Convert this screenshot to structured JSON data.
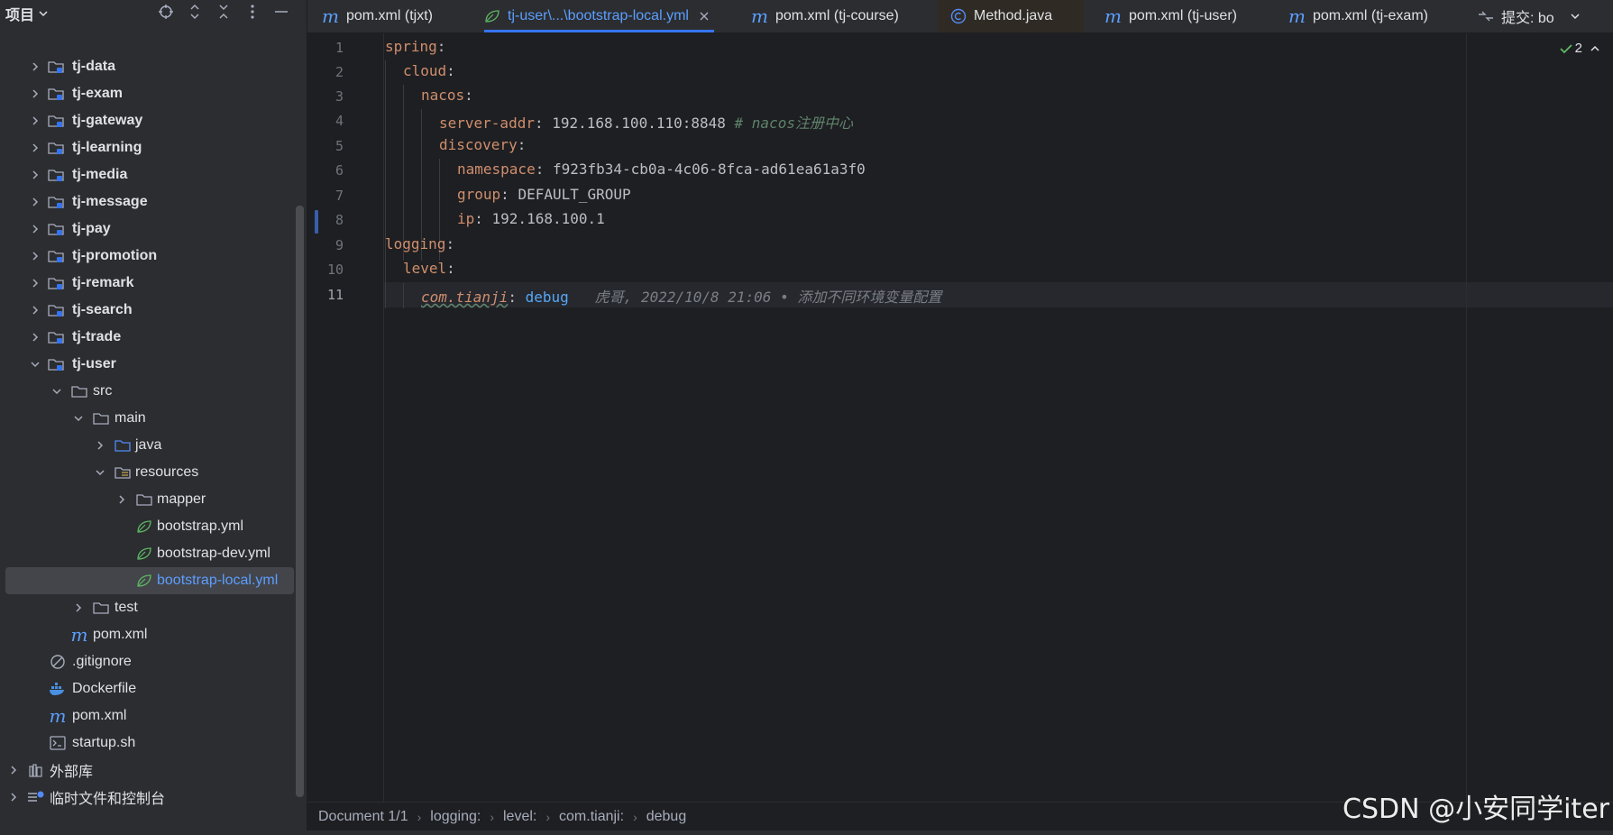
{
  "sidebar": {
    "title": "项目",
    "items": [
      {
        "label": "tj-data"
      },
      {
        "label": "tj-exam"
      },
      {
        "label": "tj-gateway"
      },
      {
        "label": "tj-learning"
      },
      {
        "label": "tj-media"
      },
      {
        "label": "tj-message"
      },
      {
        "label": "tj-pay"
      },
      {
        "label": "tj-promotion"
      },
      {
        "label": "tj-remark"
      },
      {
        "label": "tj-search"
      },
      {
        "label": "tj-trade"
      },
      {
        "label": "tj-user"
      },
      {
        "label": "src"
      },
      {
        "label": "main"
      },
      {
        "label": "java"
      },
      {
        "label": "resources"
      },
      {
        "label": "mapper"
      },
      {
        "label": "bootstrap.yml"
      },
      {
        "label": "bootstrap-dev.yml"
      },
      {
        "label": "bootstrap-local.yml"
      },
      {
        "label": "test"
      },
      {
        "label": "pom.xml"
      },
      {
        "label": ".gitignore"
      },
      {
        "label": "Dockerfile"
      },
      {
        "label": "pom.xml"
      },
      {
        "label": "startup.sh"
      },
      {
        "label": "外部库"
      },
      {
        "label": "临时文件和控制台"
      }
    ]
  },
  "tabs": [
    {
      "label": "pom.xml (tjxt)"
    },
    {
      "label": "tj-user\\...\\bootstrap-local.yml"
    },
    {
      "label": "pom.xml (tj-course)"
    },
    {
      "label": "Method.java"
    },
    {
      "label": "pom.xml (tj-user)"
    },
    {
      "label": "pom.xml (tj-exam)"
    },
    {
      "label": "提交: bo"
    }
  ],
  "editor": {
    "line_numbers": [
      "1",
      "2",
      "3",
      "4",
      "5",
      "6",
      "7",
      "8",
      "9",
      "10",
      "11"
    ],
    "l1_key": "spring",
    "l2_key": "cloud",
    "l3_key": "nacos",
    "l4_key": "server-addr",
    "l4_val": "192.168.100.110:8848",
    "l4_comment": "# nacos注册中心",
    "l5_key": "discovery",
    "l6_key": "namespace",
    "l6_val": "f923fb34-cb0a-4c06-8fca-ad61ea61a3f0",
    "l7_key": "group",
    "l7_val": "DEFAULT_GROUP",
    "l8_key": "ip",
    "l8_val": "192.168.100.1",
    "l9_key": "logging",
    "l10_key": "level",
    "l11_key": "com.tianji",
    "l11_val": "debug",
    "l11_blame": "虎哥, 2022/10/8 21:06 • 添加不同环境变量配置",
    "inspection_count": "2"
  },
  "breadcrumb": [
    "Document 1/1",
    "logging:",
    "level:",
    "com.tianji:",
    "debug"
  ],
  "watermark": "CSDN @小安同学iter",
  "colors": {
    "accent": "#3574f0",
    "selected_text": "#5c9eff",
    "yaml_key": "#cf8e6d"
  }
}
